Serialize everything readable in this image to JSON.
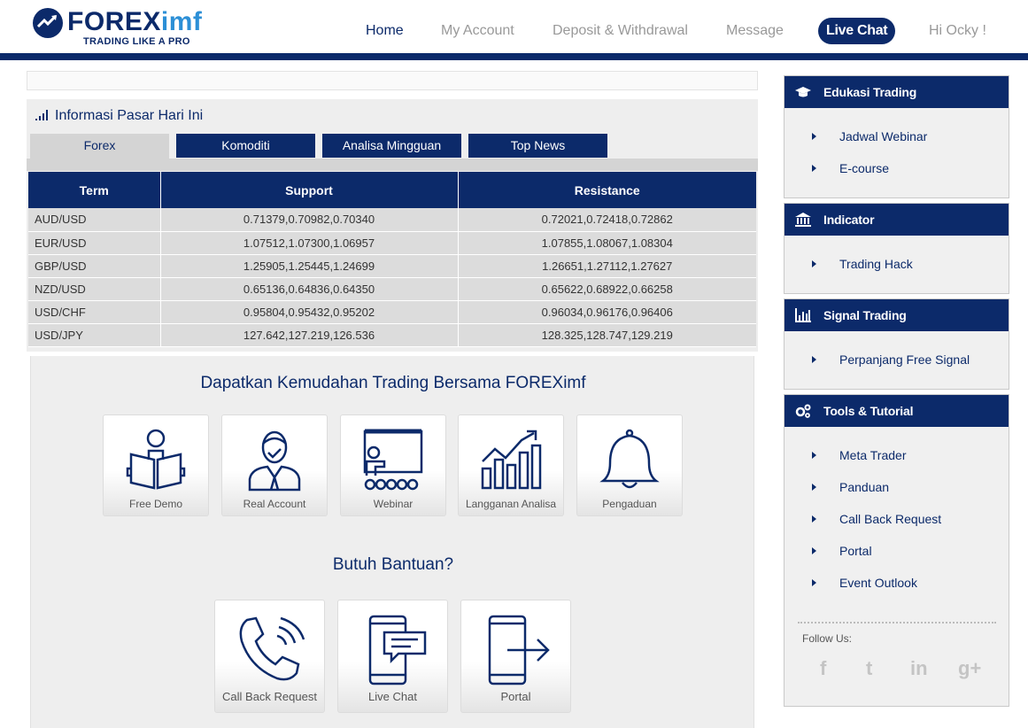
{
  "brand": {
    "name_main": "FOREX",
    "name_accent": "imf",
    "tagline": "TRADING LIKE A PRO",
    "primary_color": "#0c2a6a",
    "accent_color": "#2c8fd6"
  },
  "nav": {
    "home": "Home",
    "my_account": "My Account",
    "deposit": "Deposit & Withdrawal",
    "message": "Message",
    "live_chat": "Live Chat",
    "greeting": "Hi Ocky !"
  },
  "market": {
    "title": "Informasi Pasar Hari Ini",
    "tabs": [
      "Forex",
      "Komoditi",
      "Analisa Mingguan",
      "Top News"
    ],
    "active_tab": "Forex",
    "columns": [
      "Term",
      "Support",
      "Resistance"
    ],
    "rows": [
      {
        "term": "AUD/USD",
        "support": "0.71379,0.70982,0.70340",
        "resistance": "0.72021,0.72418,0.72862"
      },
      {
        "term": "EUR/USD",
        "support": "1.07512,1.07300,1.06957",
        "resistance": "1.07855,1.08067,1.08304"
      },
      {
        "term": "GBP/USD",
        "support": "1.25905,1.25445,1.24699",
        "resistance": "1.26651,1.27112,1.27627"
      },
      {
        "term": "NZD/USD",
        "support": "0.65136,0.64836,0.64350",
        "resistance": "0.65622,0.68922,0.66258"
      },
      {
        "term": "USD/CHF",
        "support": "0.95804,0.95432,0.95202",
        "resistance": "0.96034,0.96176,0.96406"
      },
      {
        "term": "USD/JPY",
        "support": "127.642,127.219,126.536",
        "resistance": "128.325,128.747,129.219"
      }
    ]
  },
  "features": {
    "title": "Dapatkan Kemudahan Trading Bersama FOREXimf",
    "cards": [
      {
        "label": "Free Demo",
        "icon": "reader-book-icon"
      },
      {
        "label": "Real Account",
        "icon": "businessman-icon"
      },
      {
        "label": "Webinar",
        "icon": "presentation-board-icon"
      },
      {
        "label": "Langganan Analisa",
        "icon": "growth-chart-icon"
      },
      {
        "label": "Pengaduan",
        "icon": "bell-icon"
      }
    ]
  },
  "help": {
    "title": "Butuh Bantuan?",
    "cards": [
      {
        "label": "Call Back Request",
        "icon": "phone-call-icon"
      },
      {
        "label": "Live Chat",
        "icon": "mobile-chat-icon"
      },
      {
        "label": "Portal",
        "icon": "mobile-portal-icon"
      }
    ]
  },
  "sidebar": {
    "edukasi": {
      "title": "Edukasi Trading",
      "icon": "graduation-cap-icon",
      "items": [
        "Jadwal Webinar",
        "E-course"
      ]
    },
    "indicator": {
      "title": "Indicator",
      "icon": "bank-icon",
      "items": [
        "Trading Hack"
      ]
    },
    "signal": {
      "title": "Signal Trading",
      "icon": "bar-chart-icon",
      "items": [
        "Perpanjang Free Signal"
      ]
    },
    "tools": {
      "title": "Tools & Tutorial",
      "icon": "gears-icon",
      "items": [
        "Meta Trader",
        "Panduan",
        "Call Back Request",
        "Portal",
        "Event Outlook"
      ]
    },
    "follow_label": "Follow Us:",
    "social": [
      {
        "glyph": "f",
        "icon": "facebook-icon"
      },
      {
        "glyph": "t",
        "icon": "twitter-icon"
      },
      {
        "glyph": "in",
        "icon": "linkedin-icon"
      },
      {
        "glyph": "g+",
        "icon": "google-plus-icon"
      }
    ]
  }
}
